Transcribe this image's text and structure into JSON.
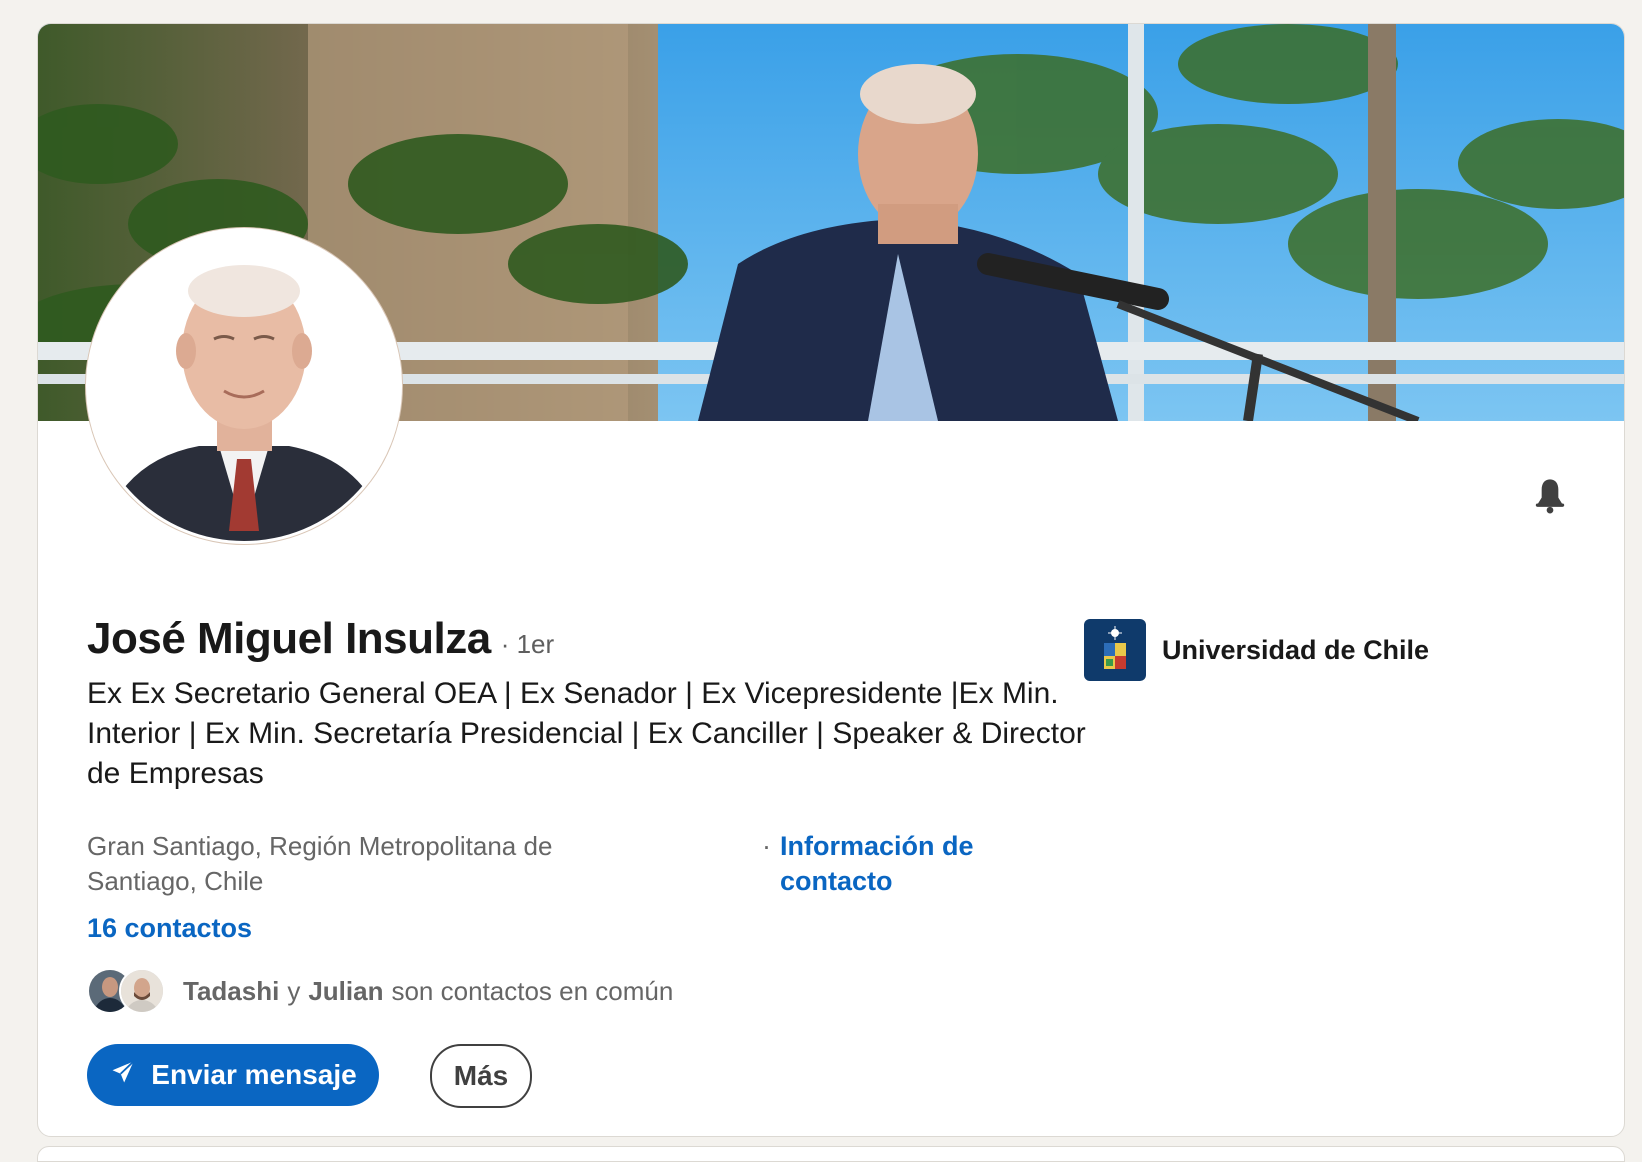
{
  "profile": {
    "name": "José Miguel Insulza",
    "degree": "· 1er",
    "headline": "Ex Ex Secretario General OEA | Ex Senador | Ex Vicepresidente |Ex Min. Interior | Ex Min. Secretaría Presidencial | Ex Canciller | Speaker & Director de Empresas",
    "location": "Gran Santiago, Región Metropolitana de Santiago, Chile",
    "contact_info_label": "Información de contacto",
    "connections_label": "16 contactos"
  },
  "mutual": {
    "first": "Tadashi",
    "conj": "y",
    "second": "Julian",
    "suffix": "son contactos en común"
  },
  "actions": {
    "message_label": "Enviar mensaje",
    "more_label": "Más"
  },
  "education": {
    "name": "Universidad de Chile"
  },
  "colors": {
    "brand_blue": "#0a66c2",
    "page_bg": "#f4f2ee"
  },
  "icons": [
    "bell-icon",
    "send-icon",
    "university-logo"
  ]
}
